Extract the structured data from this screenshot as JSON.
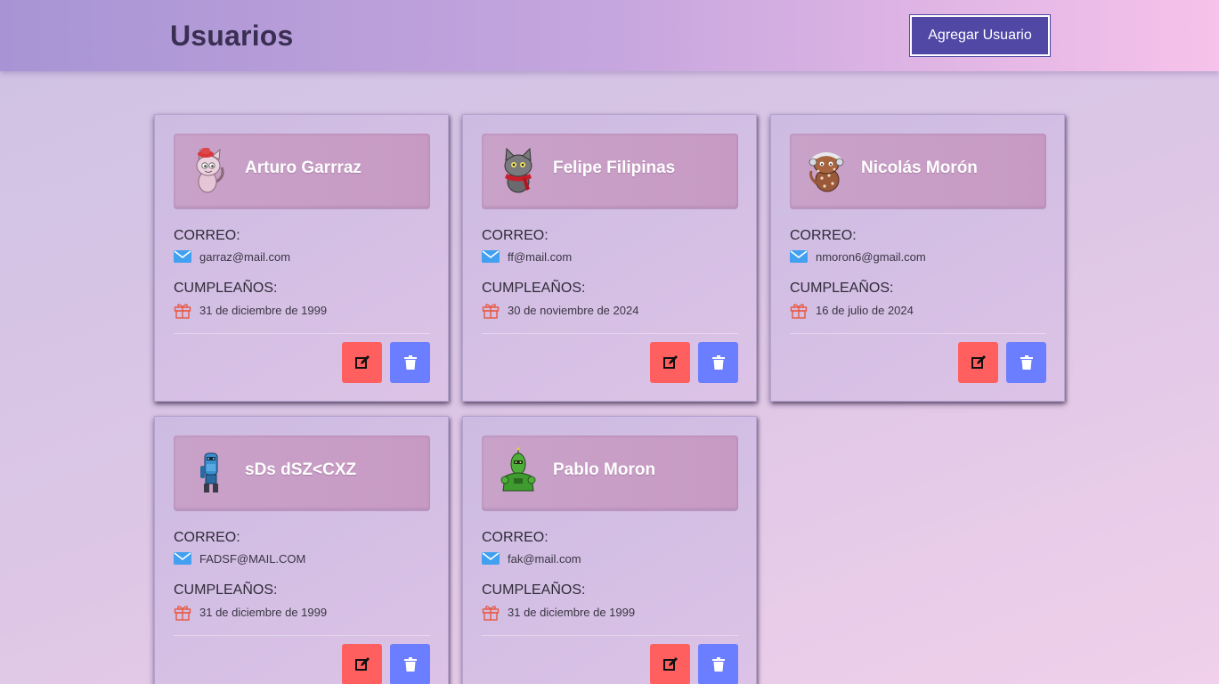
{
  "header": {
    "title": "Usuarios",
    "add_button_label": "Agregar Usuario"
  },
  "labels": {
    "email": "CORREO:",
    "birthday": "CUMPLEAÑOS:"
  },
  "colors": {
    "edit_button": "#ff605f",
    "delete_button": "#6b7eff",
    "mail_icon": "#42a0f0",
    "gift_icon": "#e8563e"
  },
  "users": [
    {
      "name": "Arturo Garrraz",
      "email": "garraz@mail.com",
      "birthday": "31 de diciembre de 1999",
      "avatar": "pink-cat-avatar"
    },
    {
      "name": "Felipe Filipinas",
      "email": "ff@mail.com",
      "birthday": "30 de noviembre de 2024",
      "avatar": "gray-cat-avatar"
    },
    {
      "name": "Nicolás Morón",
      "email": "nmoron6@gmail.com",
      "birthday": "16 de julio de 2024",
      "avatar": "spotted-creature-avatar"
    },
    {
      "name": "sDs dSZ<CXZ",
      "email": "FADSF@MAIL.COM",
      "birthday": "31 de diciembre de 1999",
      "avatar": "blue-robot-avatar"
    },
    {
      "name": "Pablo Moron",
      "email": "fak@mail.com",
      "birthday": "31 de diciembre de 1999",
      "avatar": "green-robot-avatar"
    }
  ]
}
